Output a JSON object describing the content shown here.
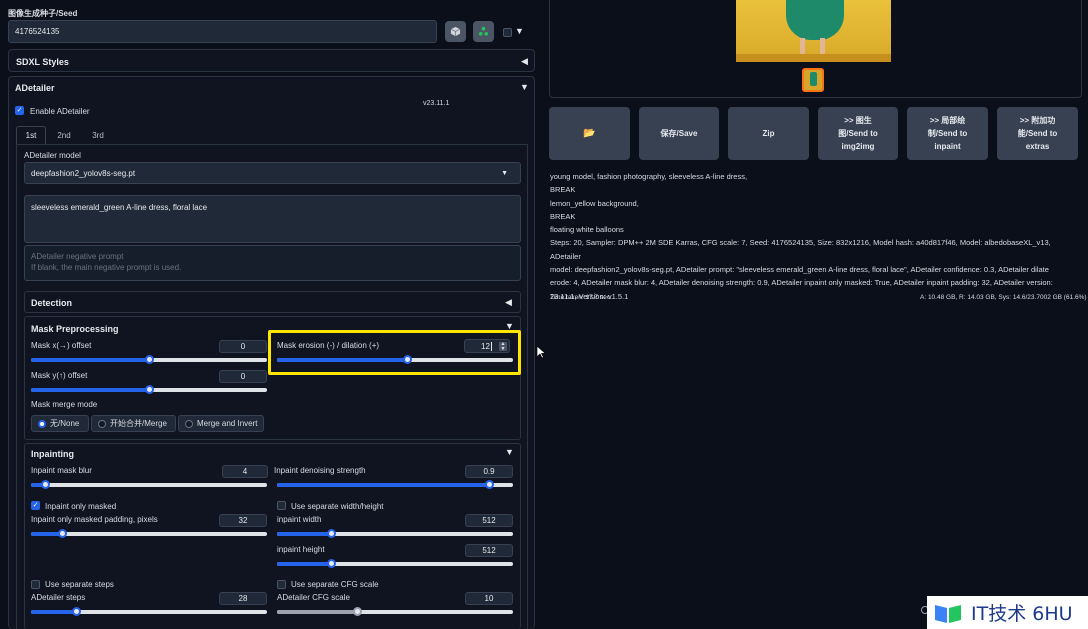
{
  "seed": {
    "label": "图像生成种子/Seed",
    "value": "4176524135"
  },
  "sdxl_styles": {
    "title": "SDXL Styles"
  },
  "adetailer": {
    "title": "ADetailer",
    "enable_label": "Enable ADetailer",
    "version": "v23.11.1",
    "tabs": [
      "1st",
      "2nd",
      "3rd"
    ],
    "model_label": "ADetailer model",
    "model_value": "deepfashion2_yolov8s-seg.pt",
    "prompt_value": "sleeveless emerald_green A-line dress, floral lace",
    "neg_placeholder_1": "ADetailer negative prompt",
    "neg_placeholder_2": "If blank, the main negative prompt is used."
  },
  "detection": {
    "title": "Detection"
  },
  "mask_preprocessing": {
    "title": "Mask Preprocessing",
    "x_offset": {
      "label": "Mask x(→) offset",
      "value": "0",
      "fraction": 0.5
    },
    "y_offset": {
      "label": "Mask y(↑) offset",
      "value": "0",
      "fraction": 0.5
    },
    "erosion": {
      "label": "Mask erosion (-) / dilation (+)",
      "value": "12",
      "fraction": 0.55
    },
    "merge_label": "Mask merge mode",
    "merge_options": [
      "无/None",
      "开始合并/Merge",
      "Merge and Invert"
    ]
  },
  "inpainting": {
    "title": "Inpainting",
    "mask_blur": {
      "label": "Inpaint mask blur",
      "value": "4",
      "fraction": 0.06
    },
    "denoise": {
      "label": "Inpaint denoising strength",
      "value": "0.9",
      "fraction": 0.9
    },
    "only_masked_label": "Inpaint only masked",
    "only_masked_padding": {
      "label": "Inpaint only masked padding, pixels",
      "value": "32",
      "fraction": 0.13
    },
    "separate_wh_label": "Use separate width/height",
    "width": {
      "label": "inpaint width",
      "value": "512",
      "fraction": 0.23
    },
    "height": {
      "label": "inpaint height",
      "value": "512",
      "fraction": 0.23
    },
    "separate_steps_label": "Use separate steps",
    "steps": {
      "label": "ADetailer steps",
      "value": "28",
      "fraction": 0.19
    },
    "separate_cfg_label": "Use separate CFG scale",
    "cfg": {
      "label": "ADetailer CFG scale",
      "value": "10",
      "fraction": 0.34
    }
  },
  "output_buttons": {
    "folder": "📂",
    "save": "保存/Save",
    "zip": "Zip",
    "img2img": ">> 图生图/Send to img2img",
    "inpaint": ">> 局部绘制/Send to inpaint",
    "extras": ">> 附加功能/Send to extras"
  },
  "generation_info": {
    "lines": [
      "young model, fashion photography, sleeveless A-line dress,",
      "BREAK",
      "lemon_yellow background,",
      "BREAK",
      "floating white balloons",
      "Steps: 20, Sampler: DPM++ 2M SDE Karras, CFG scale: 7, Seed: 4176524135, Size: 832x1216, Model hash: a40d817f46, Model: albedobaseXL_v13, ADetailer",
      "model: deepfashion2_yolov8s-seg.pt, ADetailer prompt: \"sleeveless emerald_green A-line dress, floral lace\", ADetailer confidence: 0.3, ADetailer dilate",
      "erode: 4, ADetailer mask blur: 4, ADetailer denoising strength: 0.9, ADetailer inpaint only masked: True, ADetailer inpaint padding: 32, ADetailer version:",
      "23.11.1, Version: v1.5.1"
    ],
    "time_taken": "Time taken: 17.7 sec.",
    "vram": "A: 10.48 GB, R: 14.03 GB, Sys: 14.6/23.7002 GB (61.6%)"
  },
  "watermark": "IT技术 6HU",
  "colors": {
    "accent": "#2563eb",
    "highlight": "#ffe600",
    "panel": "#0f1420"
  }
}
